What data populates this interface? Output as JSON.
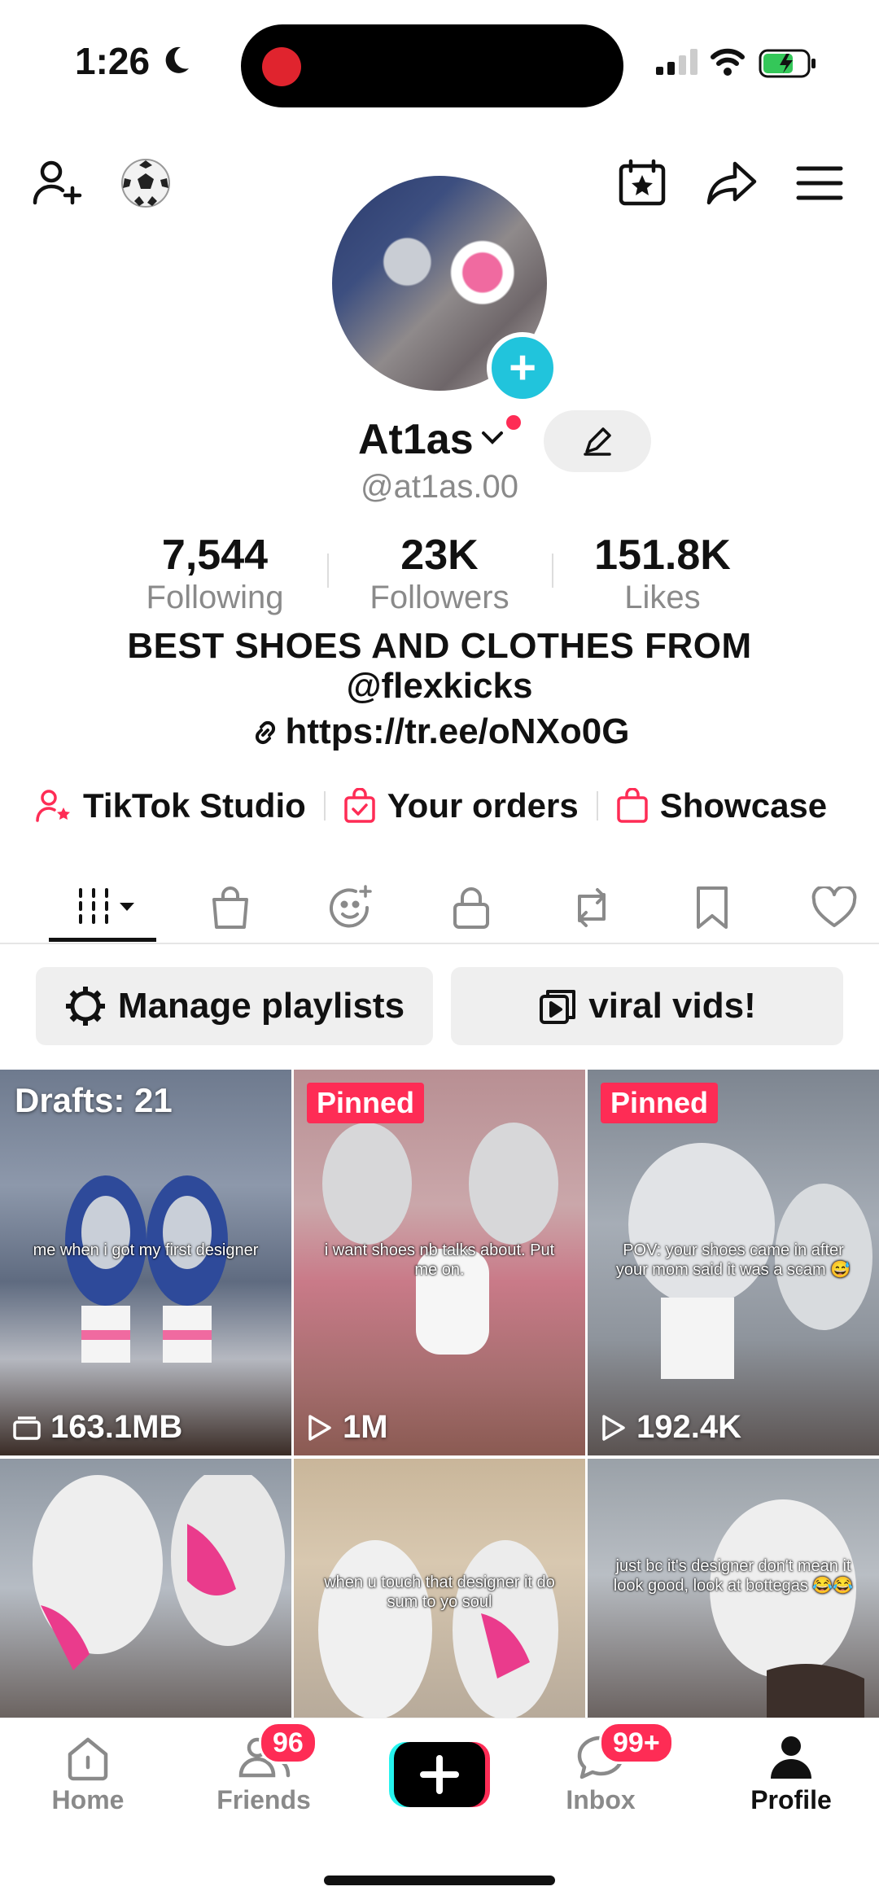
{
  "status": {
    "time": "1:26"
  },
  "profile": {
    "display_name": "At1as",
    "username": "@at1as.00",
    "stats": [
      {
        "value": "7,544",
        "label": "Following"
      },
      {
        "value": "23K",
        "label": "Followers"
      },
      {
        "value": "151.8K",
        "label": "Likes"
      }
    ],
    "bio_line1": "BEST SHOES AND CLOTHES FROM",
    "bio_line2": "@flexkicks",
    "link": "https://tr.ee/oNXo0G"
  },
  "shortcuts": {
    "studio": "TikTok Studio",
    "orders": "Your orders",
    "showcase": "Showcase"
  },
  "playlists": {
    "manage": "Manage playlists",
    "viral": "viral vids!"
  },
  "videos": [
    {
      "overlay": "Drafts: 21",
      "caption": "me when i got my first designer",
      "stat": "163.1MB"
    },
    {
      "overlay": "Pinned",
      "caption": "i want shoes nb talks about. Put me on.",
      "stat": "1M"
    },
    {
      "overlay": "Pinned",
      "caption": "POV: your shoes came in after your mom said it was a scam 😅",
      "stat": "192.4K"
    },
    {
      "caption": ""
    },
    {
      "caption": "when u touch that designer it do sum to yo soul"
    },
    {
      "caption": "just bc it's designer don't mean it look good, look at bottegas 😂😂"
    }
  ],
  "nav": {
    "home": "Home",
    "friends": "Friends",
    "friends_badge": "96",
    "inbox": "Inbox",
    "inbox_badge": "99+",
    "profile": "Profile"
  },
  "colors": {
    "accent": "#fe2c55",
    "cyan": "#21c4dc",
    "muted": "#8a8a8a"
  }
}
